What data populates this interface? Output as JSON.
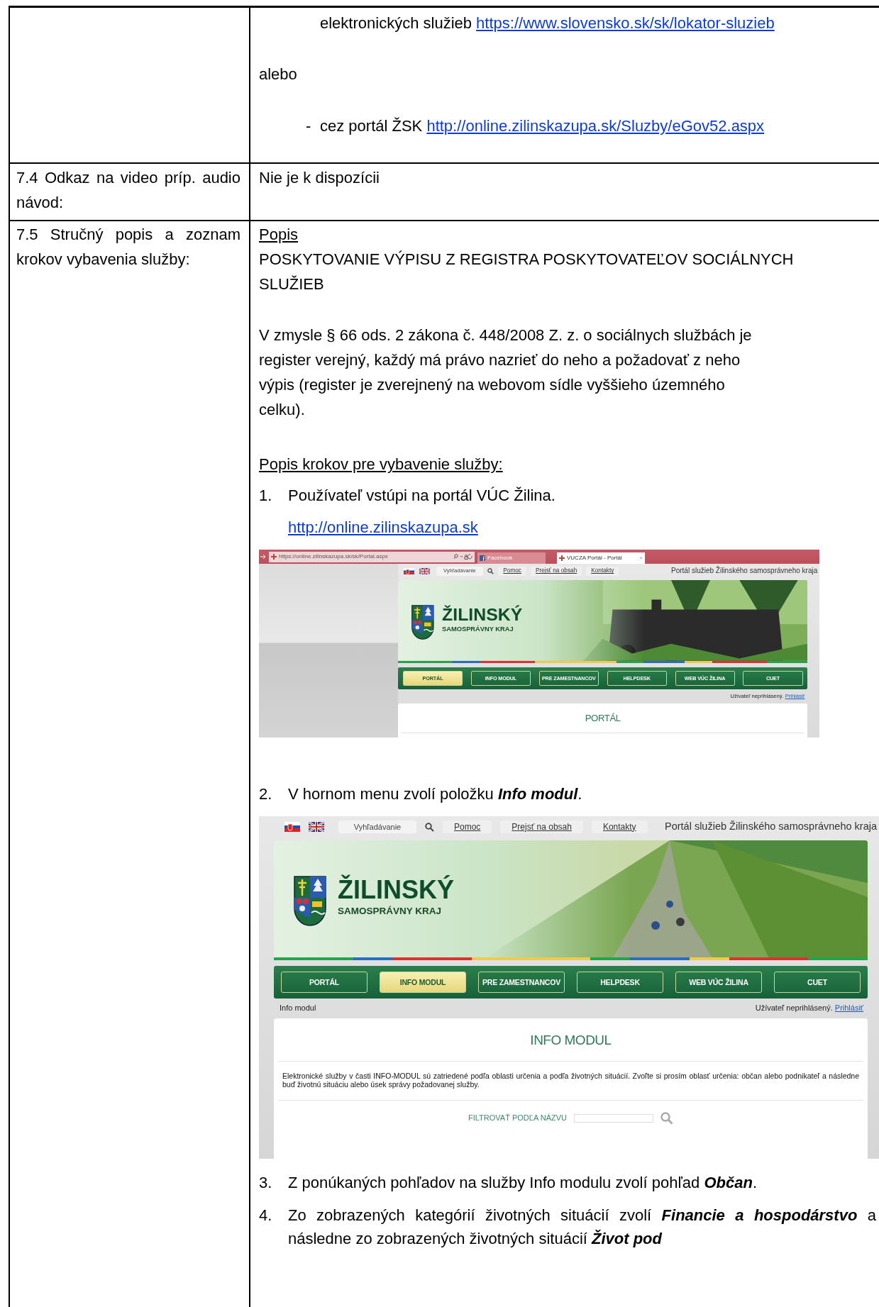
{
  "continued_row": {
    "text": "elektronických služieb",
    "link": "https://www.slovensko.sk/sk/lokator-sluzieb",
    "alternative": "alebo",
    "bullet": "-",
    "portal_text": "cez portál ŽSK",
    "portal_link": "http://online.zilinskazupa.sk/Sluzby/eGov52.aspx"
  },
  "video_row": {
    "label": "7.4 Odkaz na video príp. audio návod:",
    "value": "Nie je k dispozícii"
  },
  "steps_row": {
    "label": "7.5 Stručný popis a zoznam krokov vybavenia služby:",
    "heading": "Popis",
    "title": "POSKYTOVANIE VÝPISU Z REGISTRA POSKYTOVATEĽOV SOCIÁLNYCH SLUŽIEB",
    "paragraph": "V zmysle § 66 ods. 2 zákona č. 448/2008 Z. z. o sociálnych službách je register verejný, každý má právo nazrieť do neho a požadovať z neho výpis (register je zverejnený na webovom sídle vyššieho územného celku).",
    "steps_heading": "Popis krokov pre vybavenie služby:",
    "steps": [
      {
        "number": "1.",
        "text": "Používateľ vstúpi na portál VÚC Žilina.",
        "link": "http://online.zilinskazupa.sk",
        "screenshot": {
          "kind": "browser_window",
          "browser": {
            "address": "https://online.zilinskazupa.sk/sk/Portal.aspx",
            "tab_close": "×",
            "tabs": [
              {
                "label": "Facebook",
                "selected": false
              },
              {
                "label": "VUCZA Portál - Portál",
                "selected": true
              }
            ]
          },
          "search_placeholder": "Vyhľadávanie",
          "links": [
            "Pomoc",
            "Prejsť na obsah",
            "Kontakty"
          ],
          "tagline": "Portál služieb Žilinského samosprávneho kraja",
          "brand_title": "ŽILINSKÝ",
          "brand_subtitle": "SAMOSPRÁVNY KRAJ",
          "nav": [
            {
              "label": "PORTÁL",
              "selected": true
            },
            {
              "label": "INFO MODUL",
              "selected": false
            },
            {
              "label": "PRE ZAMESTNANCOV",
              "selected": false
            },
            {
              "label": "HELPDESK",
              "selected": false
            },
            {
              "label": "WEB VÚC ŽILINA",
              "selected": false
            },
            {
              "label": "CUET",
              "selected": false
            }
          ],
          "user_status": "Užívateľ neprihlásený.",
          "login_link": "Prihlásiť",
          "panel_title": "PORTÁL"
        }
      },
      {
        "number": "2.",
        "text": "V hornom menu zvolí položku **Info modul**.",
        "screenshot": {
          "kind": "page_crop",
          "search_placeholder": "Vyhľadávanie",
          "links": [
            "Pomoc",
            "Prejsť na obsah",
            "Kontakty"
          ],
          "tagline": "Portál služieb Žilinského samosprávneho kraja",
          "brand_title": "ŽILINSKÝ",
          "brand_subtitle": "SAMOSPRÁVNY KRAJ",
          "nav": [
            {
              "label": "PORTÁL",
              "selected": false
            },
            {
              "label": "INFO MODUL",
              "selected": true
            },
            {
              "label": "PRE ZAMESTNANCOV",
              "selected": false
            },
            {
              "label": "HELPDESK",
              "selected": false
            },
            {
              "label": "WEB VÚC ŽILINA",
              "selected": false
            },
            {
              "label": "CUET",
              "selected": false
            }
          ],
          "breadcrumb": "Info modul",
          "user_status": "Užívateľ neprihlásený.",
          "login_link": "Prihlásiť",
          "panel_title": "INFO MODUL",
          "description": "Elektronické služby v časti INFO-MODUL sú zatriedené podľa oblasti určenia a podľa životných situácií. Zvoľte si prosím oblasť určenia: občan alebo podnikateľ a následne buď životnú situáciu alebo úsek správy požadovanej služby.",
          "filter_label": "FILTROVAŤ PODĽA NÁZVU"
        }
      },
      {
        "number": "3.",
        "text": "Z ponúkaných pohľadov na služby Info modulu zvolí pohľad **Občan**."
      },
      {
        "number": "4.",
        "text": "Zo zobrazených kategórií životných situácií zvolí **Financie a hospodárstvo** a následne zo zobrazených životných situácií **Život pod**"
      }
    ]
  }
}
